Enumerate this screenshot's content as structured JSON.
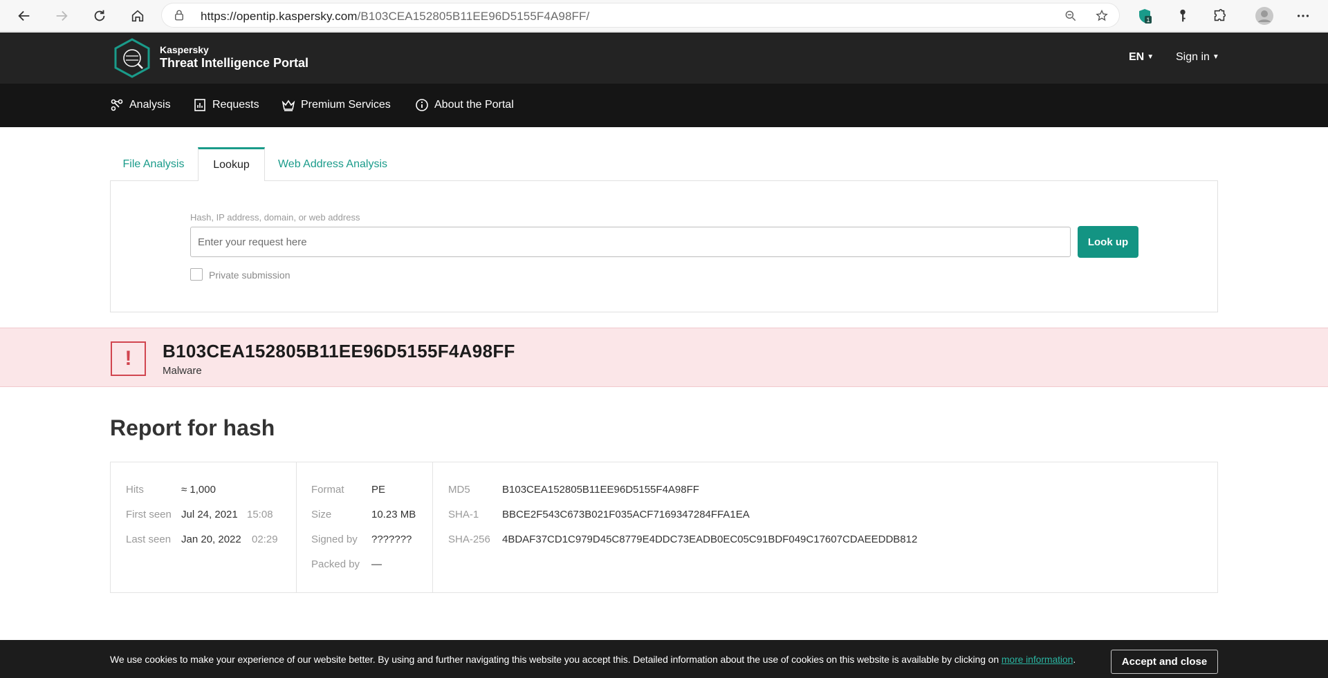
{
  "browser": {
    "url_host": "https://opentip.kaspersky.com",
    "url_path": "/B103CEA152805B11EE96D5155F4A98FF/",
    "shield_badge": "1"
  },
  "header": {
    "brand_small": "Kaspersky",
    "brand_big": "Threat Intelligence Portal",
    "language": "EN",
    "signin": "Sign in"
  },
  "nav": {
    "items": [
      {
        "label": "Analysis",
        "icon": "analysis-icon"
      },
      {
        "label": "Requests",
        "icon": "requests-icon"
      },
      {
        "label": "Premium Services",
        "icon": "crown-icon"
      },
      {
        "label": "About the Portal",
        "icon": "info-icon"
      }
    ]
  },
  "tabs": {
    "file_analysis": "File Analysis",
    "lookup": "Lookup",
    "web_address": "Web Address Analysis",
    "active": "Lookup"
  },
  "lookup": {
    "field_label": "Hash, IP address, domain, or web address",
    "placeholder": "Enter your request here",
    "value": "",
    "button": "Look up",
    "private_label": "Private submission",
    "private_checked": false
  },
  "verdict": {
    "hash": "B103CEA152805B11EE96D5155F4A98FF",
    "label": "Malware",
    "icon": "exclamation-icon",
    "color": "#d1454f"
  },
  "report": {
    "title": "Report for hash",
    "stats": {
      "hits_key": "Hits",
      "hits_val": "≈ 1,000",
      "first_seen_key": "First seen",
      "first_seen_date": "Jul 24, 2021",
      "first_seen_time": "15:08",
      "last_seen_key": "Last seen",
      "last_seen_date": "Jan 20, 2022",
      "last_seen_time": "02:29"
    },
    "file": {
      "format_key": "Format",
      "format_val": "PE",
      "size_key": "Size",
      "size_val": "10.23 MB",
      "signed_key": "Signed by",
      "signed_val": "???????",
      "packed_key": "Packed by",
      "packed_val": "—"
    },
    "hashes": {
      "md5_key": "MD5",
      "md5_val": "B103CEA152805B11EE96D5155F4A98FF",
      "sha1_key": "SHA-1",
      "sha1_val": "BBCE2F543C673B021F035ACF7169347284FFA1EA",
      "sha256_key": "SHA-256",
      "sha256_val": "4BDAF37CD1C979D45C8779E4DDC73EADB0EC05C91BDF049C17607CDAEEDDB812"
    }
  },
  "cookie": {
    "text": "We use cookies to make your experience of our website better. By using and further navigating this website you accept this. Detailed information about the use of cookies on this website is available by clicking on ",
    "link": "more information",
    "suffix": ".",
    "button": "Accept and close"
  },
  "colors": {
    "accent": "#139483",
    "header_bg": "#232323",
    "nav_bg": "#151515",
    "verdict_bg": "#fbe6e8"
  }
}
